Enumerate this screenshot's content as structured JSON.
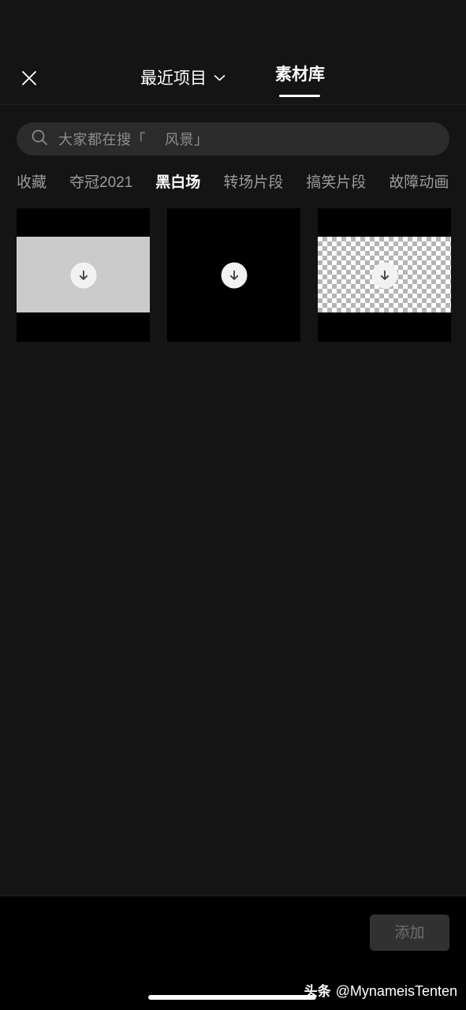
{
  "colors": {
    "page_background": "#141414",
    "bottom_background": "#000000",
    "search_pill": "#2b2b2b",
    "accent_active": "#ffffff",
    "inactive_text": "#9a9a9a",
    "placeholder_text": "#8d8d8d",
    "add_button_fill": "#313131",
    "add_button_text": "#6e6e6e",
    "thumb_gray_band": "#cbcbcb",
    "thumb_black": "#000000"
  },
  "header": {
    "close_icon": "close-icon",
    "recent_tab": {
      "label": "最近项目",
      "chevron_icon": "chevron-down-icon",
      "active": false
    },
    "library_tab": {
      "label": "素材库",
      "active": true
    }
  },
  "search": {
    "icon": "search-icon",
    "placeholder_prefix": "大家都在搜「",
    "placeholder_emoji": "rainbow-emoji",
    "placeholder_suffix": "风景」",
    "value": ""
  },
  "categories": {
    "items": [
      {
        "label": "收藏",
        "active": false
      },
      {
        "label": "夺冠2021",
        "active": false
      },
      {
        "label": "黑白场",
        "active": true
      },
      {
        "label": "转场片段",
        "active": false
      },
      {
        "label": "搞笑片段",
        "active": false
      },
      {
        "label": "故障动画",
        "active": false
      }
    ]
  },
  "grid": {
    "items": [
      {
        "name": "white-screen-clip",
        "style": "gray-band",
        "download_icon": "download-icon"
      },
      {
        "name": "black-screen-clip",
        "style": "black",
        "download_icon": "download-icon"
      },
      {
        "name": "transparent-screen-clip",
        "style": "checkerboard",
        "download_icon": "download-icon"
      }
    ]
  },
  "bottom": {
    "add_button": {
      "label": "添加",
      "enabled": false
    }
  },
  "watermark": {
    "logo": "头条",
    "handle": "@MynameisTenten"
  }
}
